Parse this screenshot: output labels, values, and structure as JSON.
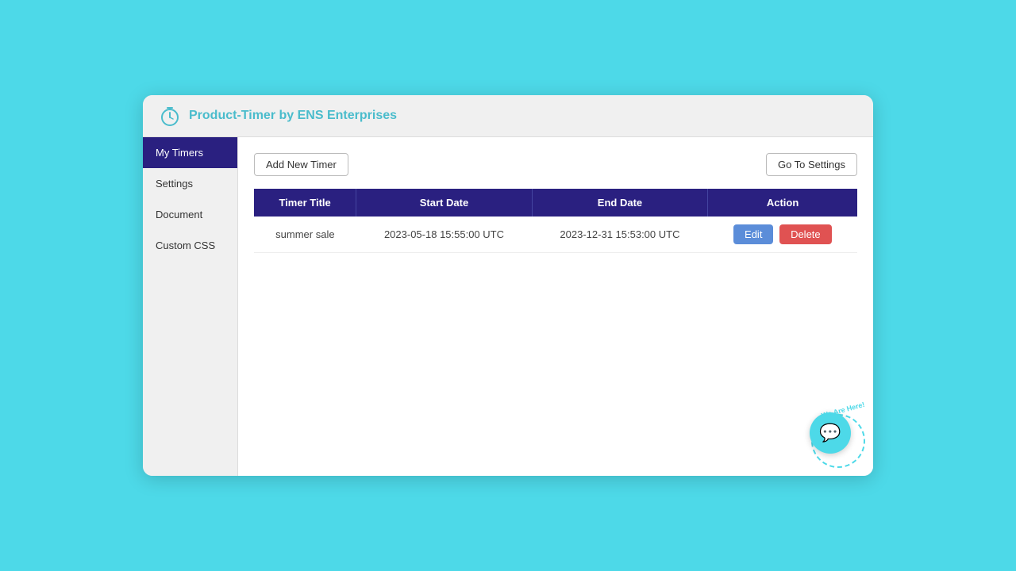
{
  "header": {
    "title": "Product-Timer by ",
    "brand": "ENS Enterprises",
    "icon_label": "timer-icon"
  },
  "sidebar": {
    "items": [
      {
        "label": "My Timers",
        "active": true
      },
      {
        "label": "Settings",
        "active": false
      },
      {
        "label": "Document",
        "active": false
      },
      {
        "label": "Custom CSS",
        "active": false
      }
    ]
  },
  "toolbar": {
    "add_button_label": "Add New Timer",
    "settings_button_label": "Go To Settings"
  },
  "table": {
    "columns": [
      "Timer Title",
      "Start Date",
      "End Date",
      "Action"
    ],
    "rows": [
      {
        "title": "summer sale",
        "start_date": "2023-05-18 15:55:00 UTC",
        "end_date": "2023-12-31 15:53:00 UTC"
      }
    ],
    "edit_label": "Edit",
    "delete_label": "Delete"
  },
  "chat": {
    "label": "We Are Here!"
  }
}
